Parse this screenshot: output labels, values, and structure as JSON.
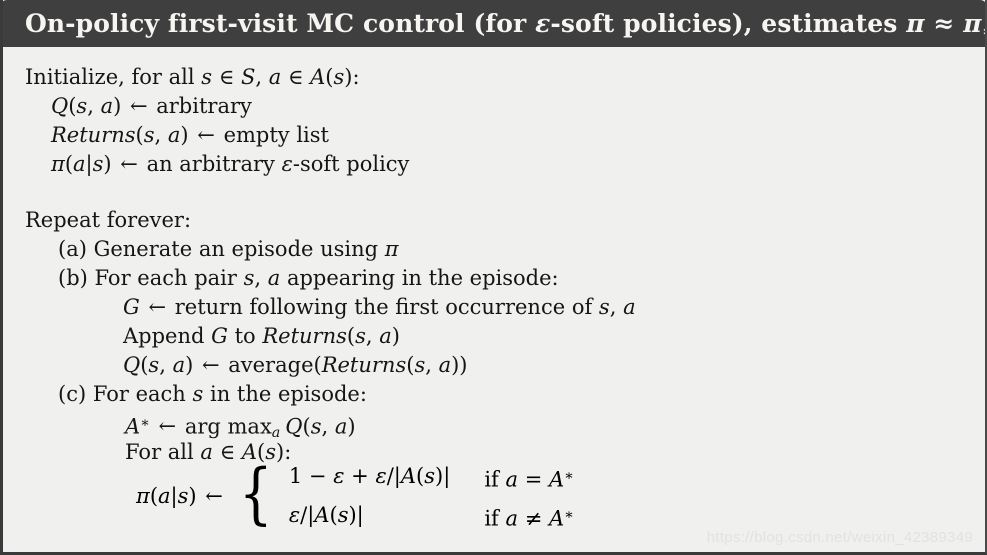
{
  "header": {
    "title_parts": [
      {
        "t": "On-policy first-visit MC control (for ",
        "k": "r"
      },
      {
        "t": "ε",
        "k": "i"
      },
      {
        "t": "-soft policies), estimates ",
        "k": "r"
      },
      {
        "t": "π",
        "k": "i"
      },
      {
        "t": " ≈ ",
        "k": "r"
      },
      {
        "t": "π",
        "k": "i"
      },
      {
        "t": "∗",
        "k": "s"
      }
    ],
    "title_text": "On-policy first-visit MC control (for ε-soft policies), estimates π ≈ π∗",
    "bg_color": "#3f3f3f",
    "text_color": "#f7f5f2"
  },
  "body": {
    "bg_color": "#f0f0ef",
    "text_color": "#151515",
    "lines": [
      {
        "id": "init-header",
        "indent": 0,
        "text": "Initialize, for all s ∈ S, a ∈ A(s):"
      },
      {
        "id": "init-q",
        "indent": 1,
        "text": "Q(s, a) ← arbitrary"
      },
      {
        "id": "init-returns",
        "indent": 1,
        "text": "Returns(s, a) ← empty list"
      },
      {
        "id": "init-pi",
        "indent": 1,
        "text": "π(a|s) ← an arbitrary ε-soft policy"
      },
      {
        "id": "blank",
        "indent": 0,
        "text": ""
      },
      {
        "id": "repeat-header",
        "indent": 0,
        "text": "Repeat forever:"
      },
      {
        "id": "step-a",
        "indent": 2,
        "text": "(a) Generate an episode using π"
      },
      {
        "id": "step-b",
        "indent": 2,
        "text": "(b) For each pair s, a appearing in the episode:"
      },
      {
        "id": "step-b-g",
        "indent": 3,
        "text": "G ← return following the first occurrence of s, a"
      },
      {
        "id": "step-b-append",
        "indent": 3,
        "text": "Append G to Returns(s, a)"
      },
      {
        "id": "step-b-q",
        "indent": 3,
        "text": "Q(s, a) ← average(Returns(s, a))"
      },
      {
        "id": "step-c",
        "indent": 2,
        "text": "(c) For each s in the episode:"
      },
      {
        "id": "step-c-astar",
        "indent": 3,
        "text": "A∗ ← arg max_a Q(s, a)"
      },
      {
        "id": "step-c-forall",
        "indent": 3,
        "text": "For all a ∈ A(s):"
      }
    ]
  },
  "cases": {
    "lhs": "π(a|s) ←",
    "rows": [
      {
        "value": "1 − ε + ε/|A(s)|",
        "condition": "if a = A∗"
      },
      {
        "value": "ε/|A(s)|",
        "condition": "if a ≠ A∗"
      }
    ]
  },
  "watermark": {
    "text": "https://blog.csdn.net/weixin_42389349"
  }
}
